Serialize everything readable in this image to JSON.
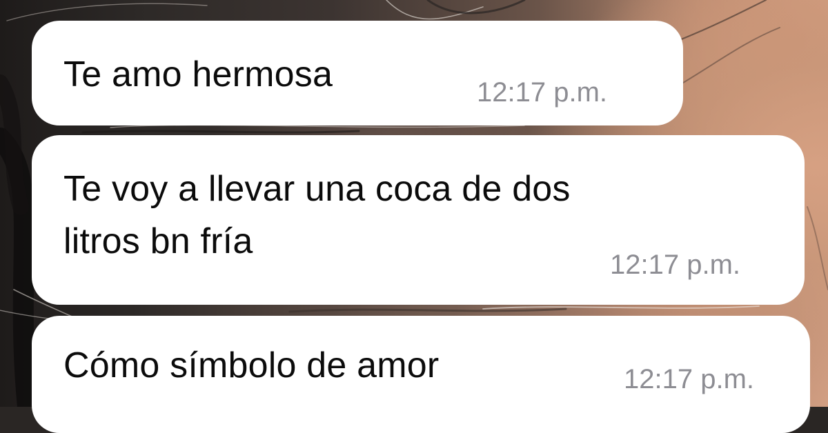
{
  "messages": [
    {
      "text": "Te amo hermosa",
      "time": "12:17 p.m."
    },
    {
      "text": "Te voy a llevar una coca de dos\nlitros bn fría",
      "time": "12:17 p.m."
    },
    {
      "text": "Cómo símbolo de amor",
      "time": "12:17 p.m."
    }
  ],
  "colors": {
    "bubble": "#ffffff",
    "message_text": "#0b0b0b",
    "timestamp": "#8d8d93"
  }
}
